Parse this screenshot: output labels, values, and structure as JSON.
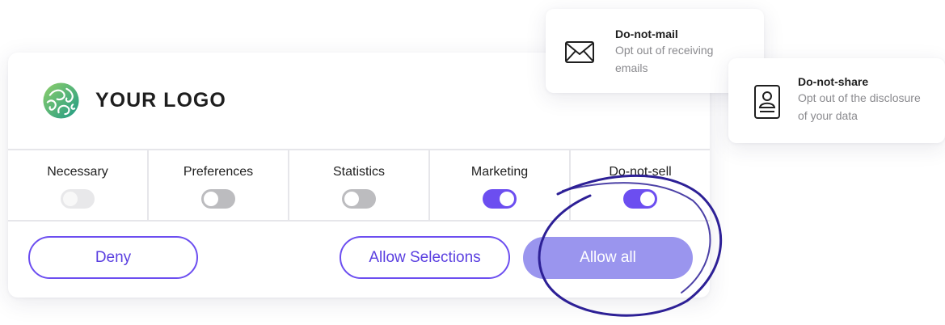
{
  "brand": {
    "logo_text": "YOUR LOGO",
    "logo_icon": "swirl-globe-icon",
    "accent_color": "#6c4ef0",
    "allow_all_color": "#9a95ee",
    "scribble_color": "#2d2096"
  },
  "categories": [
    {
      "label": "Necessary",
      "state": "disabled"
    },
    {
      "label": "Preferences",
      "state": "off"
    },
    {
      "label": "Statistics",
      "state": "off"
    },
    {
      "label": "Marketing",
      "state": "on"
    },
    {
      "label": "Do-not-sell",
      "state": "on"
    }
  ],
  "buttons": {
    "deny": "Deny",
    "allow_selections": "Allow Selections",
    "allow_all": "Allow all"
  },
  "info_cards": {
    "mail": {
      "icon": "envelope-icon",
      "title": "Do-not-mail",
      "description": "Opt out of receiving emails"
    },
    "share": {
      "icon": "id-badge-icon",
      "title": "Do-not-share",
      "description": "Opt out of the disclosure of your data"
    }
  }
}
